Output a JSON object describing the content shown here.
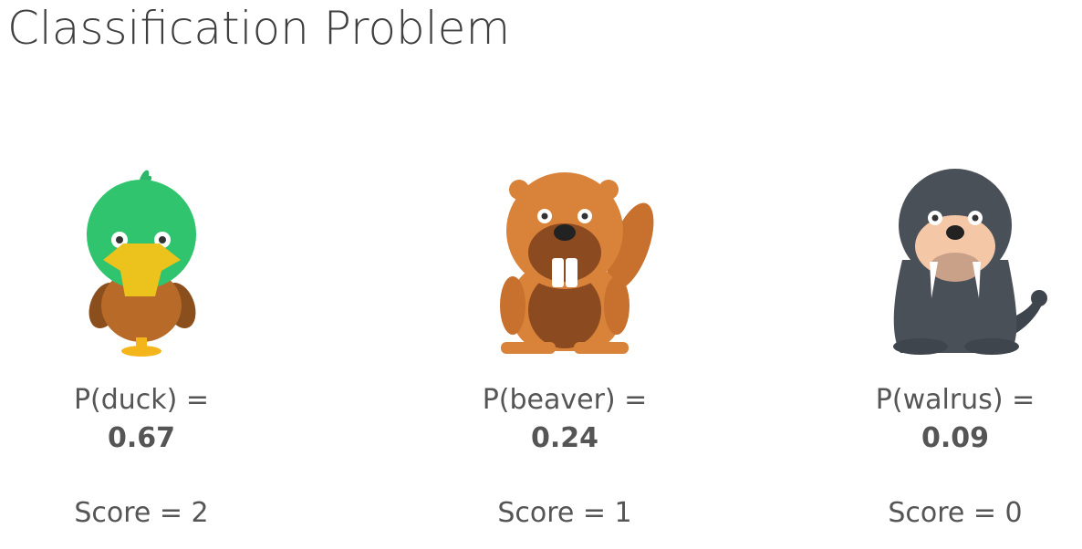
{
  "slide": {
    "title": "Classification Problem",
    "animals": [
      {
        "icon": "duck-icon",
        "prob_label": "P(duck) =",
        "prob_value": "0.67",
        "score": "Score = 2"
      },
      {
        "icon": "beaver-icon",
        "prob_label": "P(beaver) =",
        "prob_value": "0.24",
        "score": "Score = 1"
      },
      {
        "icon": "walrus-icon",
        "prob_label": "P(walrus) =",
        "prob_value": "0.09",
        "score": "Score = 0"
      }
    ]
  }
}
